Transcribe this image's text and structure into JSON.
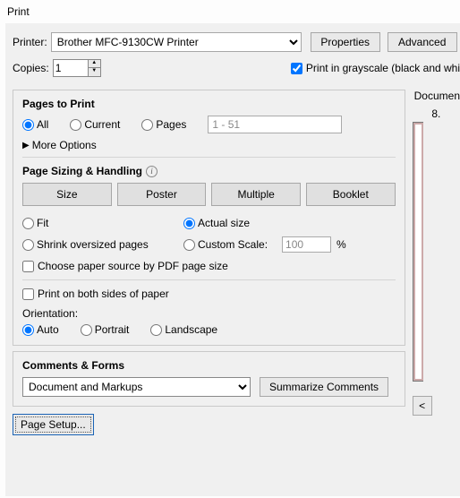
{
  "window_title": "Print",
  "top": {
    "printer_label": "Printer:",
    "printer_selected": "Brother MFC-9130CW Printer",
    "properties_btn": "Properties",
    "advanced_btn": "Advanced",
    "copies_label": "Copies:",
    "copies_value": "1",
    "grayscale_label": "Print in grayscale (black and whi"
  },
  "pages": {
    "title": "Pages to Print",
    "all": "All",
    "current": "Current",
    "pages": "Pages",
    "range_placeholder": "1 - 51",
    "more_options": "More Options"
  },
  "sizing": {
    "title": "Page Sizing & Handling",
    "size": "Size",
    "poster": "Poster",
    "multiple": "Multiple",
    "booklet": "Booklet",
    "fit": "Fit",
    "actual": "Actual size",
    "shrink": "Shrink oversized pages",
    "custom": "Custom Scale:",
    "custom_value": "100",
    "percent": "%",
    "choose_paper": "Choose paper source by PDF page size",
    "both_sides": "Print on both sides of paper",
    "orientation_label": "Orientation:",
    "auto": "Auto",
    "portrait": "Portrait",
    "landscape": "Landscape"
  },
  "comments": {
    "title": "Comments & Forms",
    "selected": "Document and Markups",
    "summarize": "Summarize Comments"
  },
  "page_setup": "Page Setup...",
  "preview": {
    "label": "Documen",
    "dim": "8.",
    "prev_btn": "<"
  }
}
